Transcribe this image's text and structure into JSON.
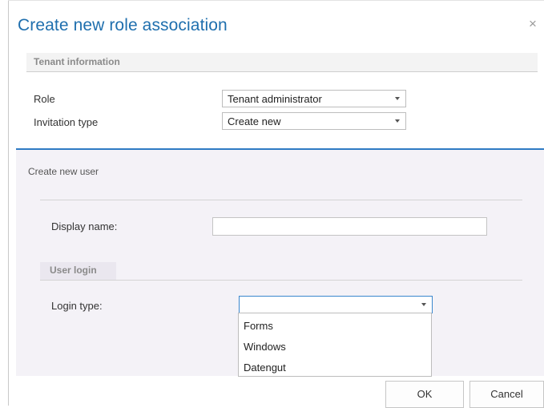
{
  "dialog": {
    "title": "Create new role association",
    "close_glyph": "×"
  },
  "tenant_section": {
    "header": "Tenant information",
    "role": {
      "label": "Role",
      "value": "Tenant administrator"
    },
    "invitation": {
      "label": "Invitation type",
      "value": "Create new"
    }
  },
  "new_user": {
    "title": "Create new user",
    "display_name": {
      "label": "Display name:",
      "value": ""
    },
    "login_header": "User login",
    "login_type": {
      "label": "Login type:",
      "value": "",
      "options": [
        "Forms",
        "Windows",
        "Datengut"
      ]
    }
  },
  "buttons": {
    "ok": "OK",
    "cancel": "Cancel"
  },
  "colors": {
    "title": "#1f6fae",
    "accent_border": "#2f7bc4",
    "panel_bg": "#f4f2f7"
  }
}
